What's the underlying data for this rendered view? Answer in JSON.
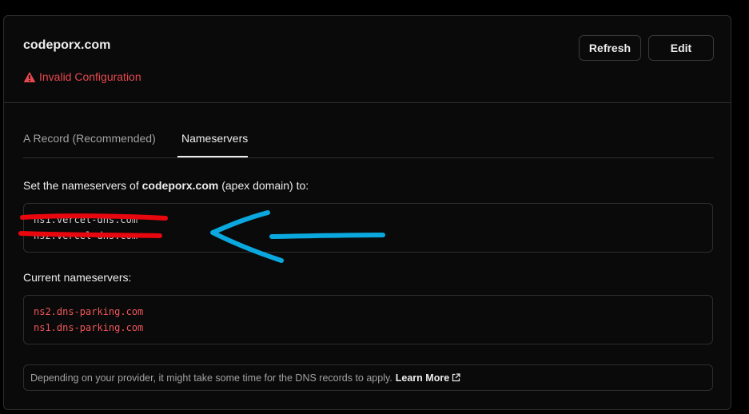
{
  "domain": {
    "title": "codeporx.com"
  },
  "status": {
    "text": "Invalid Configuration",
    "icon": "warning-triangle-icon",
    "color": "#e5484d"
  },
  "buttons": {
    "refresh": "Refresh",
    "edit": "Edit"
  },
  "tabs": [
    {
      "label": "A Record (Recommended)",
      "active": false
    },
    {
      "label": "Nameservers",
      "active": true
    }
  ],
  "instruction": {
    "prefix": "Set the nameservers of ",
    "domain": "codeporx.com",
    "suffix": " (apex domain) to:"
  },
  "target_nameservers": [
    "ns1.vercel-dns.com",
    "ns2.vercel-dns.com"
  ],
  "current_nameservers": {
    "label": "Current nameservers:",
    "values": [
      "ns2.dns-parking.com",
      "ns1.dns-parking.com"
    ]
  },
  "note": {
    "text": "Depending on your provider, it might take some time for the DNS records to apply.",
    "link": "Learn More",
    "link_icon": "external-link-icon"
  },
  "annotations": {
    "strike_color": "#e8070e",
    "arrow_color": "#0aa8de"
  }
}
